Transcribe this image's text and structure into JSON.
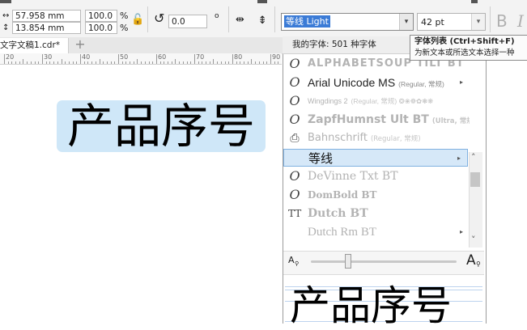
{
  "toolbar": {
    "width_value": "57.958 mm",
    "height_value": "13.854 mm",
    "scale_x": "100.0",
    "scale_y": "100.0",
    "percent": "%",
    "rotation_value": "0.0",
    "degree_symbol": "o",
    "font_name": "等线 Light",
    "font_size": "42 pt",
    "bold_glyph": "B",
    "size_arrow_glyph": "▾",
    "lock_glyph": "🔓",
    "rotate_glyph": "↺",
    "mirror_glyph": "⇹",
    "width_icon_glyph": "↔",
    "height_icon_glyph": "↕"
  },
  "tabs": {
    "document": "文字文稿1.cdr*",
    "add": "+"
  },
  "ruler": {
    "labels": [
      "20",
      "30",
      "40",
      "50",
      "60",
      "70",
      "80",
      "90"
    ]
  },
  "canvas": {
    "text": "产品序号"
  },
  "font_list": {
    "header": "我的字体: 501 种字体",
    "items": [
      {
        "name": "ALPHABETSOUP TILT BT",
        "meta": "",
        "icon": "O",
        "style": "gray"
      },
      {
        "name": "Arial Unicode MS",
        "meta": "(Regular, 常规)",
        "icon": "O",
        "style": "normal"
      },
      {
        "name": "Wingdings 2",
        "meta": "(Regular, 常规) ❂❀❁✿❃❋",
        "icon": "O",
        "style": "gray"
      },
      {
        "name": "ZapfHumnst Ult BT",
        "meta": "(Ultra, 常规)",
        "icon": "O",
        "style": "gray"
      },
      {
        "name": "Bahnschrift",
        "meta": "(Regular, 常规)",
        "icon": "⎙",
        "style": "gray"
      },
      {
        "name": "等线",
        "meta": "",
        "icon": "",
        "style": "selected"
      },
      {
        "name": "DeVinne Txt BT",
        "meta": "",
        "icon": "O",
        "style": "gray"
      },
      {
        "name": "DomBold BT",
        "meta": "",
        "icon": "O",
        "style": "gray"
      },
      {
        "name": "Dutch BT",
        "meta": "",
        "icon": "TT",
        "style": "gray"
      },
      {
        "name": "Dutch Rm BT",
        "meta": "",
        "icon": "",
        "style": "gray"
      }
    ],
    "submenu_arrow": "▸",
    "scroll_up": "˄",
    "scroll_down": "˅",
    "zoom_small_label": "A",
    "zoom_large_label": "A",
    "preview_text": "产品序号"
  },
  "tooltip": {
    "title": "字体列表 (Ctrl+Shift+F)",
    "description": "为新文本或所选文本选择一种"
  },
  "colors": {
    "selection": "#cfe7f8",
    "font_highlight": "#d6e8f8",
    "field_highlight": "#3b7bd6"
  }
}
